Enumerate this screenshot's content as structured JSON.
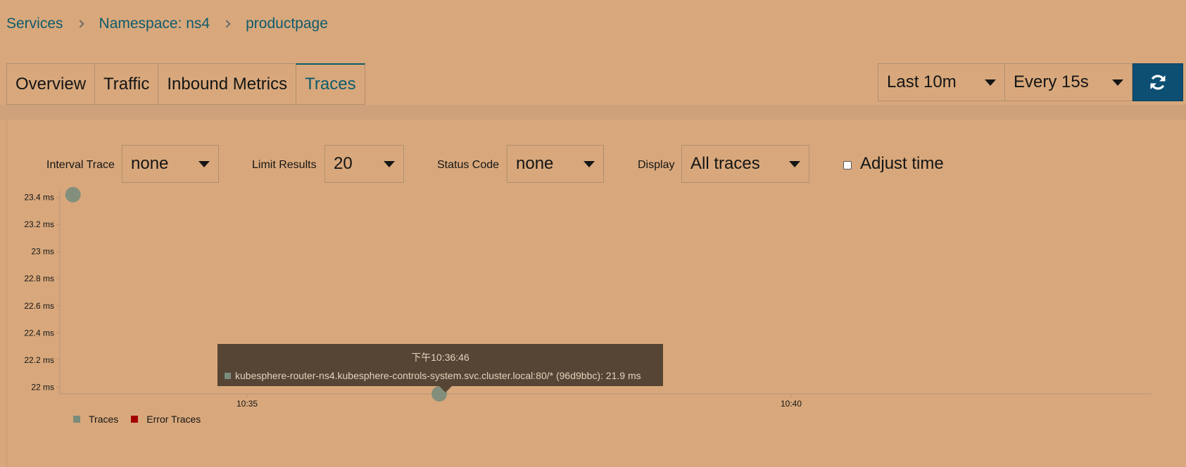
{
  "breadcrumb": {
    "items": [
      "Services",
      "Namespace: ns4",
      "productpage"
    ]
  },
  "tabs": [
    "Overview",
    "Traffic",
    "Inbound Metrics",
    "Traces"
  ],
  "active_tab": "Traces",
  "toolbar": {
    "time_range": "Last 10m",
    "refresh_interval": "Every 15s",
    "refresh_icon": "refresh-icon"
  },
  "filters": {
    "interval_trace": {
      "label": "Interval Trace",
      "value": "none"
    },
    "limit_results": {
      "label": "Limit Results",
      "value": "20"
    },
    "status_code": {
      "label": "Status Code",
      "value": "none"
    },
    "display": {
      "label": "Display",
      "value": "All traces"
    },
    "adjust_time": {
      "label": "Adjust time",
      "checked": false
    }
  },
  "chart_data": {
    "type": "scatter",
    "y_ticks": [
      "23.4 ms",
      "23.2 ms",
      "23 ms",
      "22.8 ms",
      "22.6 ms",
      "22.4 ms",
      "22.2 ms",
      "22 ms"
    ],
    "x_ticks": [
      "10:35",
      "10:40"
    ],
    "series": [
      {
        "name": "Traces",
        "color": "#7a8c7c",
        "points": [
          {
            "x": "10:33:24",
            "y": 23.42
          },
          {
            "x": "10:36:46",
            "y": 21.9
          }
        ]
      },
      {
        "name": "Error Traces",
        "color": "#a30000",
        "points": []
      }
    ],
    "ylim": [
      21.95,
      23.45
    ]
  },
  "tooltip": {
    "time": "下午10:36:46",
    "text": "kubesphere-router-ns4.kubesphere-controls-system.svc.cluster.local:80/* (96d9bbc): 21.9 ms"
  },
  "colors": {
    "background": "#d8a87c",
    "link": "#0f5b6b",
    "refresh_button": "#0d4f73",
    "tooltip_bg": "#564434"
  }
}
